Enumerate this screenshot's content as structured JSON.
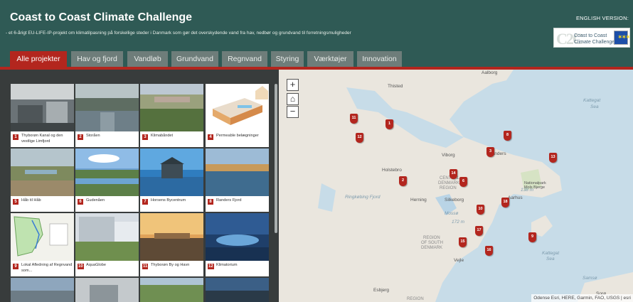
{
  "header": {
    "title": "Coast to Coast Climate Challenge",
    "subtitle": "- et 6-årigt EU-LIFE-IP-projekt om klimatilpasning på forskellige steder i Danmark som gør det overskydende vand fra hav, nedbør og grundvand til forretningsmuligheder",
    "english_link": "ENGLISH VERSION:",
    "logo_mark": "C2C",
    "logo_text_1": "Coast to Coast",
    "logo_text_2": "Climate Challenge"
  },
  "tabs": [
    {
      "label": "Alle projekter",
      "active": true
    },
    {
      "label": "Hav og fjord",
      "active": false
    },
    {
      "label": "Vandløb",
      "active": false
    },
    {
      "label": "Grundvand",
      "active": false
    },
    {
      "label": "Regnvand",
      "active": false
    },
    {
      "label": "Styring",
      "active": false
    },
    {
      "label": "Værktøjer",
      "active": false
    },
    {
      "label": "Innovation",
      "active": false
    }
  ],
  "gallery": {
    "cards": [
      {
        "num": "1",
        "label": "Thyborøn Kanal og den vestlige Limfjord"
      },
      {
        "num": "2",
        "label": "Storåen"
      },
      {
        "num": "3",
        "label": "Klimabåndet"
      },
      {
        "num": "4",
        "label": "Permeable belægninger"
      },
      {
        "num": "5",
        "label": "Håb til Håb"
      },
      {
        "num": "6",
        "label": "Gudenåen"
      },
      {
        "num": "7",
        "label": "Horsens Bycentrum"
      },
      {
        "num": "8",
        "label": "Randers Fjord"
      },
      {
        "num": "9",
        "label": "Lokal Afledning af Regnvand som..."
      },
      {
        "num": "10",
        "label": "AquaGlobe"
      },
      {
        "num": "11",
        "label": "Thyborøn By og Havn"
      },
      {
        "num": "12",
        "label": "Klimatorium"
      }
    ]
  },
  "map": {
    "zoom_in": "+",
    "home": "⌂",
    "zoom_out": "−",
    "attribution": "Odense Esri, HERE, Garmin, FAO, USGS | esri",
    "pins": [
      "11",
      "1",
      "12",
      "8",
      "3",
      "13",
      "14",
      "2",
      "6",
      "18",
      "10",
      "17",
      "15",
      "16",
      "9"
    ],
    "labels": {
      "aalborg": "Aalborg",
      "thisted": "Thisted",
      "kattegat": "Kattegat",
      "sea": "Sea",
      "viborg": "Viborg",
      "randers": "Randers",
      "holstebro": "Holstebro",
      "central": "CENTRAL",
      "denmark": "DENMARK",
      "region": "REGION",
      "herning": "Herning",
      "silkeborg": "Silkeborg",
      "aarhus": "Aarhus",
      "mossø": "Mossø",
      "national_park": "Nationalpark Mols Bjerge",
      "region_south_1": "REGION",
      "region_south_2": "OF SOUTH",
      "region_south_3": "DENMARK",
      "vejle": "Vejle",
      "kattegat2": "Kattegat",
      "sea2": "Sea",
      "esbjerg": "Esbjerg",
      "samso": "Samsø",
      "ringkobing": "Ringkøbing Fjord",
      "height_138": "138 m",
      "height_172": "172 m",
      "soro": "Sorø",
      "region_low": "REGION"
    }
  },
  "colors": {
    "header_bg": "#2f5a55",
    "accent_red": "#b3261e",
    "tab_inactive": "#6e7d7a",
    "map_land": "#e9e6df",
    "map_water": "#c7dce8"
  }
}
